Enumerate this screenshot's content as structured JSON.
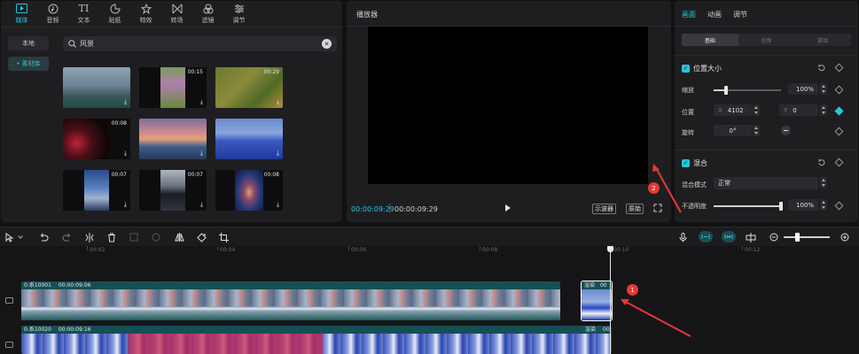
{
  "media": {
    "tabs": [
      {
        "label": "媒体",
        "icon": "media-icon",
        "active": true
      },
      {
        "label": "音频",
        "icon": "audio-icon"
      },
      {
        "label": "文本",
        "icon": "text-icon"
      },
      {
        "label": "贴纸",
        "icon": "sticker-icon"
      },
      {
        "label": "特效",
        "icon": "effects-icon"
      },
      {
        "label": "转场",
        "icon": "transition-icon"
      },
      {
        "label": "滤镜",
        "icon": "filter-icon"
      },
      {
        "label": "调节",
        "icon": "adjust-icon"
      }
    ],
    "side_nav": [
      {
        "label": "本地"
      },
      {
        "label": "• 素材库",
        "active": true
      }
    ],
    "search": {
      "value": "风景"
    },
    "thumbnails": [
      {
        "duration": ""
      },
      {
        "duration": "00:15"
      },
      {
        "duration": "00:29"
      },
      {
        "duration": "00:08"
      },
      {
        "duration": ""
      },
      {
        "duration": ""
      },
      {
        "duration": "00:07"
      },
      {
        "duration": "00:07"
      },
      {
        "duration": "00:08"
      }
    ]
  },
  "player": {
    "title": "播放器",
    "current_time": "00:00:09:29",
    "total_time": "00:00:09:29",
    "waveform_btn": "示波器",
    "original_btn": "原始"
  },
  "properties": {
    "tabs": [
      {
        "label": "画面",
        "active": true
      },
      {
        "label": "动画"
      },
      {
        "label": "调节"
      }
    ],
    "segments": [
      {
        "label": "基础",
        "active": true
      },
      {
        "label": "抠像"
      },
      {
        "label": "蒙版"
      }
    ],
    "position_size": {
      "title": "位置大小",
      "scale_label": "缩放",
      "scale_value": "100%",
      "scale_level": 0.18,
      "position_label": "位置",
      "x_prefix": "X",
      "x_value": "4102",
      "y_prefix": "Y",
      "y_value": "0",
      "rotation_label": "旋转",
      "rotation_value": "0°"
    },
    "blend": {
      "title": "混合",
      "mode_label": "混合模式",
      "mode_value": "正常",
      "opacity_label": "不透明度",
      "opacity_value": "100%",
      "opacity_level": 1.0
    }
  },
  "timeline": {
    "ruler": [
      "00:02",
      "00:04",
      "00:06",
      "00:08",
      "00:10",
      "00:12"
    ],
    "track1": {
      "title": "0:系10001",
      "duration": "00:00:09:06"
    },
    "track1_small": {
      "title": "渲染",
      "duration": "00"
    },
    "track2": {
      "title": "0:系10020",
      "duration": "00:00:09:16"
    },
    "track2_small": {
      "title": "渲染",
      "duration": "00"
    }
  },
  "annotations": [
    "1",
    "2"
  ],
  "colors": {
    "accent": "#26c6da",
    "annotation": "#e53935"
  }
}
